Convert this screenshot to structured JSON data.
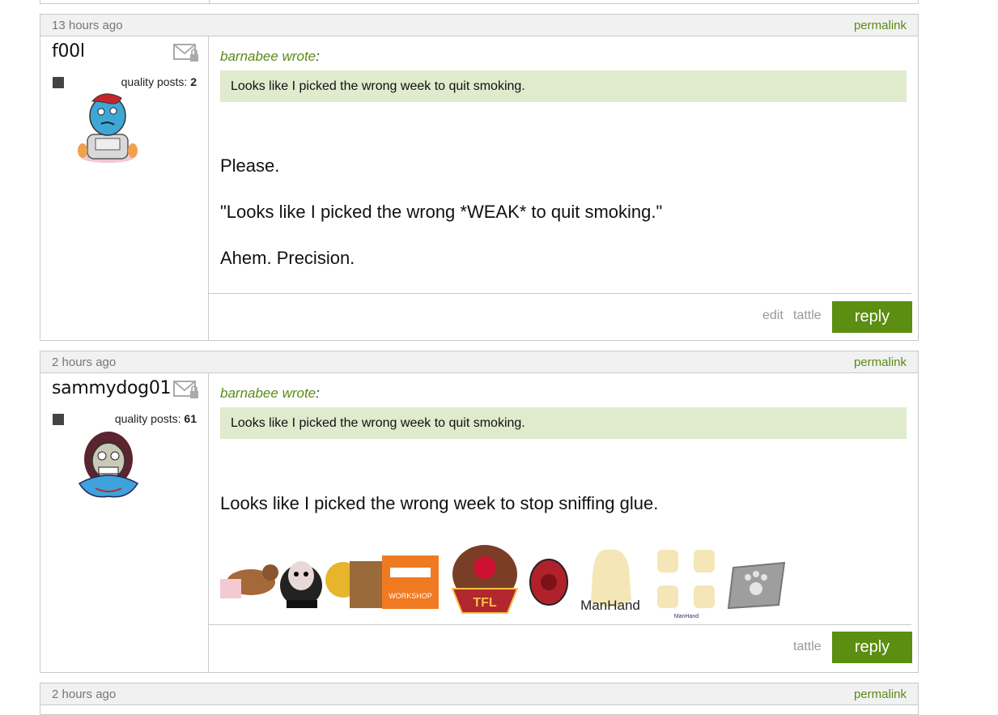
{
  "posts": [
    {
      "timestamp": "13 hours ago",
      "permalink": "permalink",
      "username": "f00l",
      "quality_label": "quality posts:",
      "quality_count": "2",
      "quote_author": "barnabee wrote",
      "quote_colon": ":",
      "quote_text": "Looks like I picked the wrong week to quit smoking.",
      "messages": [
        "Please.",
        "\"Looks like I picked the wrong *WEAK* to quit smoking.\"",
        "Ahem. Precision."
      ],
      "actions": {
        "edit": "edit",
        "tattle": "tattle",
        "reply": "reply"
      }
    },
    {
      "timestamp": "2 hours ago",
      "permalink": "permalink",
      "username": "sammydog01",
      "quality_label": "quality posts:",
      "quality_count": "61",
      "quote_author": "barnabee wrote",
      "quote_colon": ":",
      "quote_text": "Looks like I picked the wrong week to quit smoking.",
      "messages": [
        "Looks like I picked the wrong week to stop sniffing glue."
      ],
      "signature": {
        "workshop_label": "WORKSHOP",
        "tfl_label": "TFL",
        "manhand_label": "ManHand",
        "manhand_small_label": "ManHand"
      },
      "actions": {
        "tattle": "tattle",
        "reply": "reply"
      }
    },
    {
      "timestamp": "2 hours ago",
      "permalink": "permalink"
    }
  ],
  "colors": {
    "accent_green": "#5c8e12",
    "link_green": "#5c8a15",
    "quote_bg": "#e0eacd",
    "border": "#c9c9c9"
  }
}
